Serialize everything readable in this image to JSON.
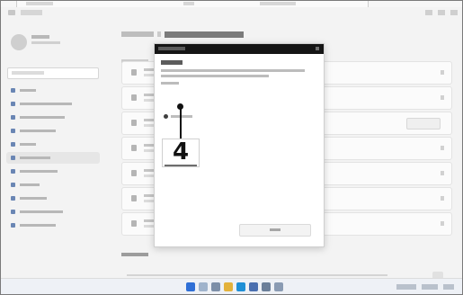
{
  "annotation": {
    "step_number": "4"
  },
  "taskbar": {
    "icons": [
      "start-icon",
      "search-icon",
      "task-view-icon",
      "file-explorer-icon",
      "browser-icon",
      "store-icon",
      "settings-icon"
    ]
  },
  "colors": {
    "dialog_titlebar": "#151515",
    "accent": "#6a86b4",
    "taskbar": "#eef1f6"
  }
}
